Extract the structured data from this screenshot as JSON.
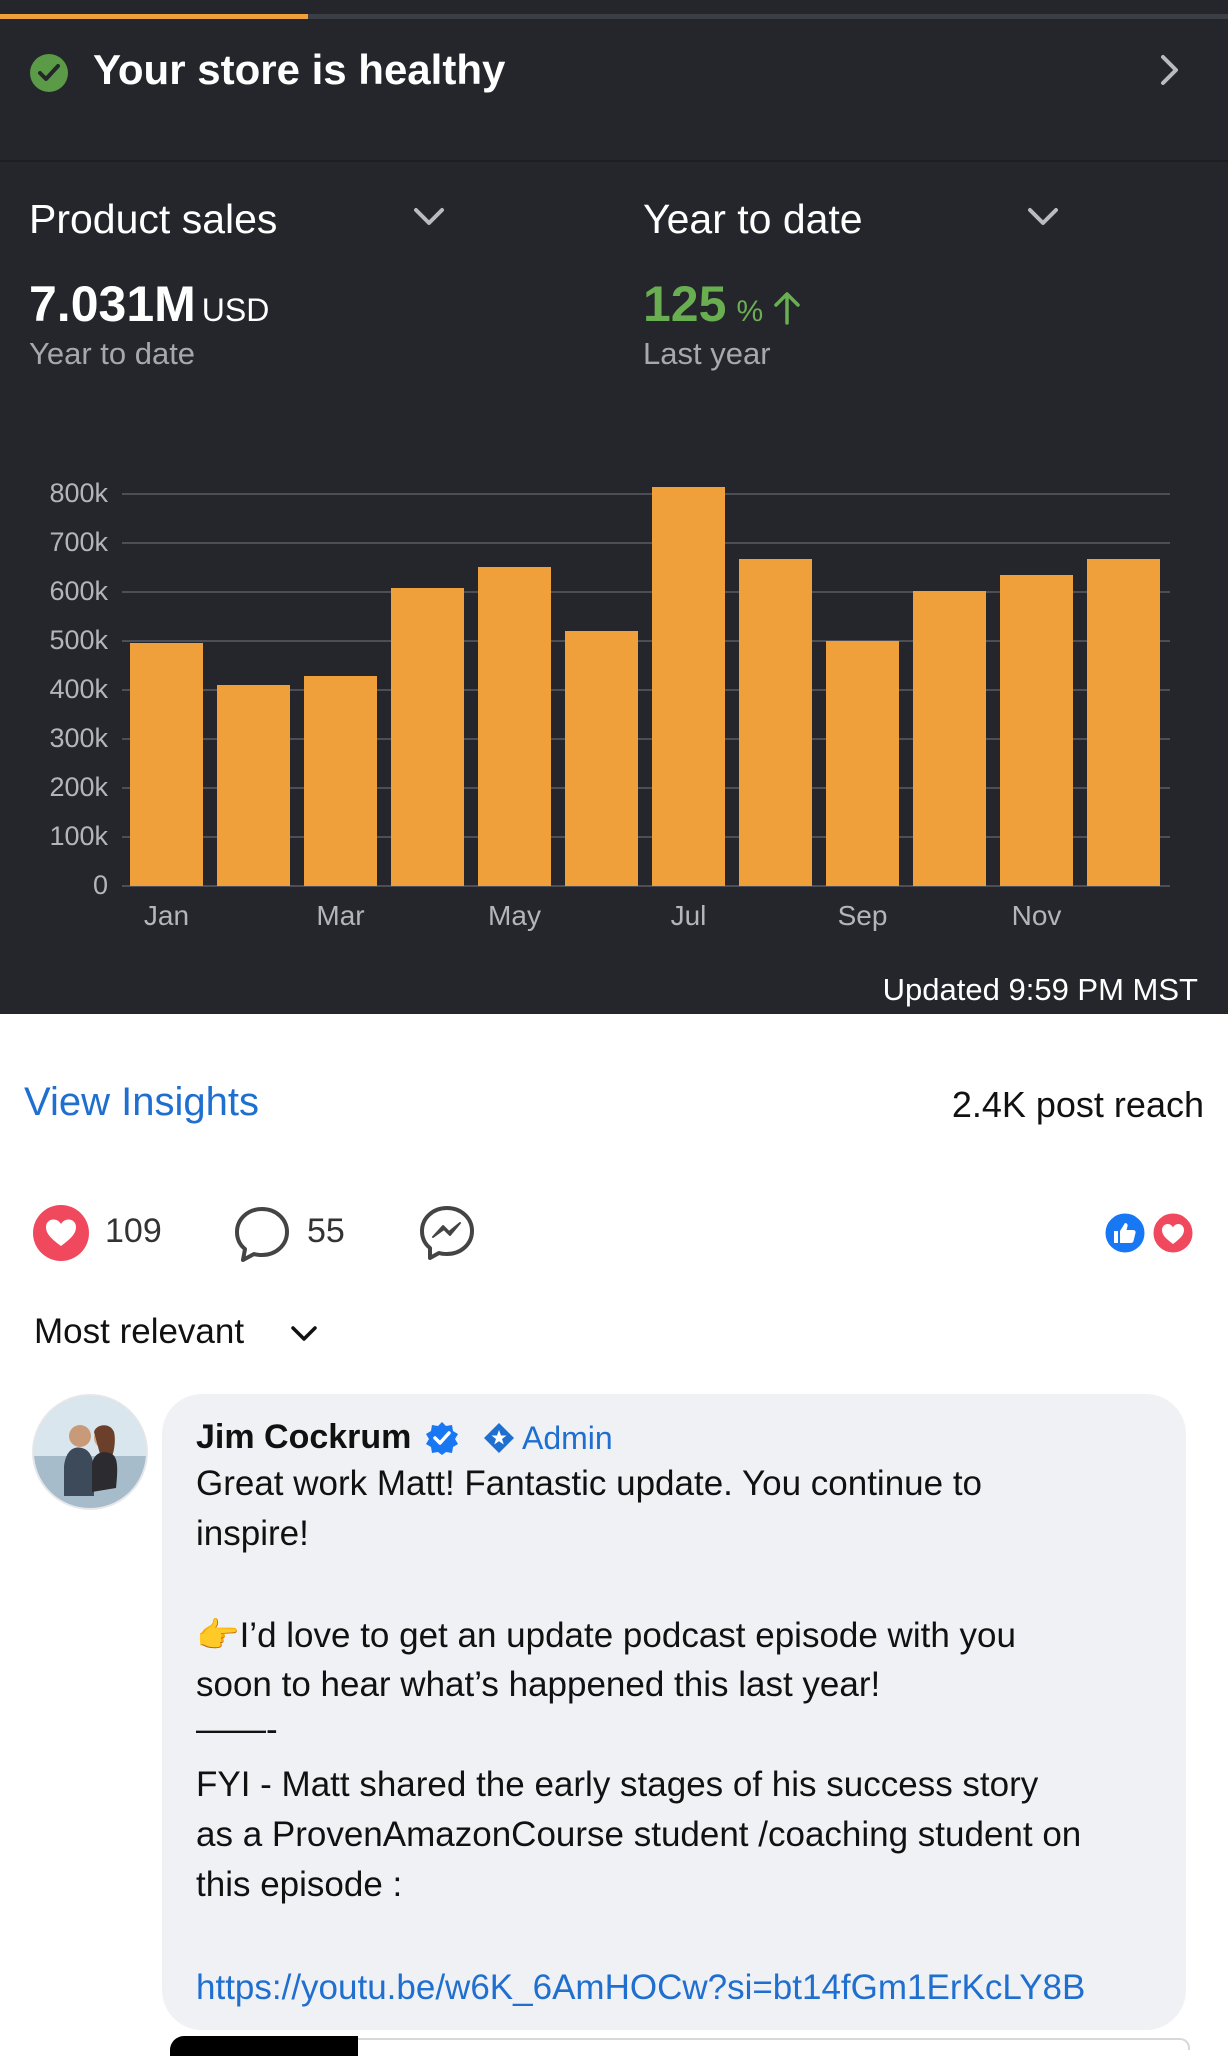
{
  "store": {
    "health_text": "Your store is healthy"
  },
  "selectors": {
    "metric_label": "Product sales",
    "period_label": "Year to date"
  },
  "kpi": {
    "value": "7.031M",
    "unit": "USD",
    "value_sub": "Year to date",
    "change": "125",
    "change_unit": "%",
    "change_direction": "up",
    "change_sub": "Last year"
  },
  "chart_data": {
    "type": "bar",
    "categories": [
      "Jan",
      "Feb",
      "Mar",
      "Apr",
      "May",
      "Jun",
      "Jul",
      "Aug",
      "Sep",
      "Oct",
      "Nov",
      "Dec"
    ],
    "x_tick_labels": [
      "Jan",
      "Mar",
      "May",
      "Jul",
      "Sep",
      "Nov"
    ],
    "values": [
      495000,
      410000,
      428000,
      608000,
      652000,
      520000,
      815000,
      667000,
      500000,
      602000,
      635000,
      667000
    ],
    "y_tick_labels": [
      "800k",
      "700k",
      "600k",
      "500k",
      "400k",
      "300k",
      "200k",
      "100k",
      "0"
    ],
    "ylim": [
      0,
      800000
    ],
    "grid": true,
    "bar_color": "#f0a03a"
  },
  "updated_text": "Updated 9:59 PM MST",
  "post": {
    "view_insights": "View Insights",
    "reach": "2.4K post reach",
    "likes": "109",
    "comments": "55",
    "sort_label": "Most relevant"
  },
  "comment": {
    "author": "Jim Cockrum",
    "badge": "Admin",
    "lines": [
      "Great work Matt! Fantastic update. You continue to",
      "inspire!",
      "",
      "👉I’d love to get an update podcast episode with you",
      "soon to hear what’s happened this last year!",
      "——-",
      "FYI - Matt shared the early stages of his success story",
      "as a ProvenAmazonCourse student /coaching student on",
      "this episode :",
      ""
    ],
    "link": "https://youtu.be/w6K_6AmHOCw?si=bt14fGm1ErKcLY8B"
  },
  "colors": {
    "accent_orange": "#f0a03a",
    "positive_green": "#6aae52",
    "link_blue": "#1f6fd1",
    "dark_bg": "#24262b"
  }
}
